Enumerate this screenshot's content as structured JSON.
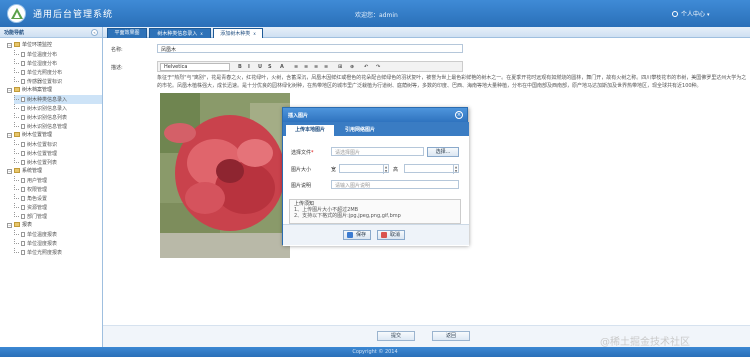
{
  "app": {
    "title": "通用后台管理系统",
    "welcome": "欢迎您：admin",
    "user_center": "个人中心",
    "footer": "Copyright © 2014"
  },
  "sidebar": {
    "title": "功能导航",
    "groups": [
      {
        "label": "单位环境监控",
        "items": [
          "单位温度分布",
          "单位湿度分布",
          "单位光照度分布",
          "传感器位置标识"
        ]
      },
      {
        "label": "树木档案管理",
        "items": [
          "树木种类信息录入",
          "树木识别信息录入",
          "树木识别信息列表",
          "树木识别信息管理"
        ]
      },
      {
        "label": "树木位置管理",
        "items": [
          "树木位置标识",
          "树木位置管理",
          "树木位置列表"
        ]
      },
      {
        "label": "系统管理",
        "items": [
          "用户管理",
          "权限管理",
          "角色设置",
          "资源管理",
          "部门管理"
        ]
      },
      {
        "label": "报表",
        "items": [
          "单位温度报表",
          "单位湿度报表",
          "单位光照度报表"
        ]
      }
    ]
  },
  "tabs": [
    {
      "label": "平面效果图"
    },
    {
      "label": "树木种类信息录入",
      "close": "x"
    },
    {
      "label": "添加树木种类",
      "close": "x"
    }
  ],
  "form": {
    "name_label": "名称:",
    "name_value": "凤凰木",
    "desc_label": "描述:",
    "font_select": "Helvetica",
    "toolbar_buttons": [
      "B",
      "I",
      "U",
      "S",
      "A",
      "≡",
      "≡",
      "≡",
      "≡",
      "⊞",
      "⊕",
      "↶",
      "↷"
    ],
    "description": "象征于\"热烈\"与\"离别\"，花是青春之火，红花绿叶，火树，含蓄深沉，凤凰木因鲜红或橙色的花朵配合鲜绿色的羽状复叶，被誉为世上最色彩鲜艳的树木之一。在夏季开花时远观有如燃烧的圆林，舞门开，故有火树之称。四川攀枝花市的市树，美国佛罗里达州大学为之的市花。凤凰木植株强大，成长迅速。是十分优良的园林绿化树种，在热带地区的城市里广泛栽植为行道树、庭荫树等，多数的印度、巴西、海南等地大量种植，分布在中国南部及西南部，原产地马达加斯加及世界热带地区，现全球共有近100种。",
    "submit_label": "提交",
    "cancel_label": "返回"
  },
  "dialog": {
    "title": "插入图片",
    "tabs": [
      "上传本地图片",
      "引用网络图片"
    ],
    "file_label": "选择文件",
    "required_mark": "*",
    "file_placeholder": "请选择图片",
    "browse_label": "选择...",
    "size_label": "图片大小",
    "width_label": "宽",
    "height_label": "高",
    "desc_label": "图片说明",
    "desc_placeholder": "请输入图片说明",
    "tips_title": "上传须知",
    "tips": [
      "1、上传图片大小不超过2MB",
      "2、支持以下格式的图片:jpg,jpeg,png,gif,bmp"
    ],
    "save_label": "保存",
    "cancel_label": "取消"
  },
  "watermark": "@稀土掘金技术社区"
}
